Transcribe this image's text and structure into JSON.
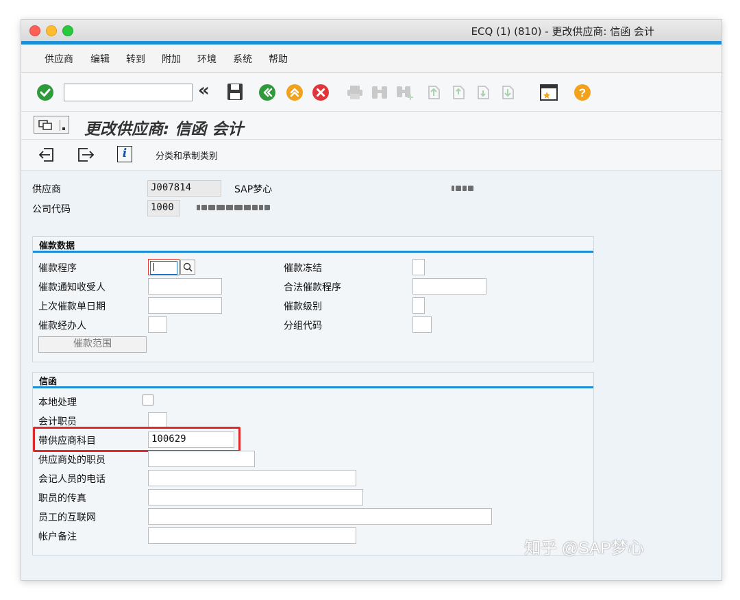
{
  "window": {
    "title": "ECQ (1) (810) - 更改供应商: 信函 会计"
  },
  "menu": [
    "供应商",
    "编辑",
    "转到",
    "附加",
    "环境",
    "系统",
    "帮助"
  ],
  "toolbar": {
    "command_value": "",
    "back_glyph": "«",
    "help_glyph": "?",
    "icons": [
      "check-icon",
      "save-icon",
      "back-icon",
      "exit-icon",
      "cancel-icon",
      "print-icon",
      "find-icon",
      "find-next-icon",
      "first-page-icon",
      "prev-page-icon",
      "next-page-icon",
      "last-page-icon",
      "create-session-icon",
      "help-icon"
    ]
  },
  "screen": {
    "title": "更改供应商: 信函 会计"
  },
  "app_toolbar": {
    "info_glyph": "i",
    "classification_link": "分类和承制类别"
  },
  "header": {
    "vendor_label": "供应商",
    "vendor_value": "J007814",
    "vendor_name": "SAP梦心",
    "company_label": "公司代码",
    "company_value": "1000"
  },
  "dunning": {
    "title": "催款数据",
    "procedure_label": "催款程序",
    "procedure_value": "",
    "recipient_label": "催款通知收受人",
    "recipient_value": "",
    "last_date_label": "上次催款单日期",
    "last_date_value": "",
    "clerk_label": "催款经办人",
    "clerk_value": "",
    "block_label": "催款冻结",
    "block_value": "",
    "legal_label": "合法催款程序",
    "legal_value": "",
    "level_label": "催款级别",
    "level_value": "",
    "grouping_label": "分组代码",
    "grouping_value": "",
    "area_button": "催款范围"
  },
  "correspondence": {
    "title": "信函",
    "local_label": "本地处理",
    "local_checked": false,
    "acct_clerk_label": "会计职员",
    "acct_clerk_value": "",
    "account_label": "带供应商科目",
    "account_value": "100629",
    "vendor_clerk_label": "供应商处的职员",
    "vendor_clerk_value": "",
    "clerk_phone_label": "会记人员的电话",
    "clerk_phone_value": "",
    "clerk_fax_label": "职员的传真",
    "clerk_fax_value": "",
    "clerk_internet_label": "员工的互联网",
    "clerk_internet_value": "",
    "account_memo_label": "帐户备注",
    "account_memo_value": ""
  },
  "watermark": "知乎 @SAP梦心"
}
